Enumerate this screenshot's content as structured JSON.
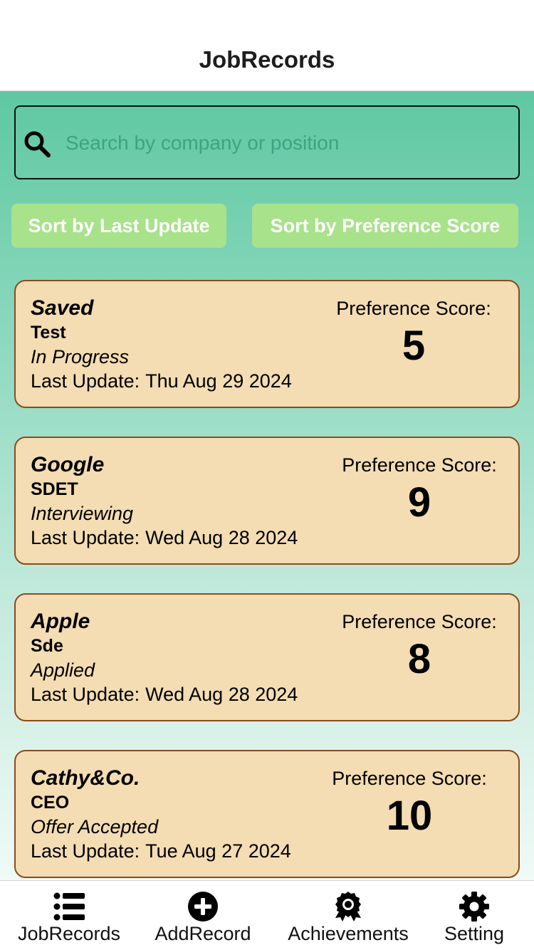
{
  "header": {
    "title": "JobRecords"
  },
  "search": {
    "placeholder": "Search by company or position",
    "value": ""
  },
  "sort": {
    "last_update_label": "Sort by Last Update",
    "preference_label": "Sort by Preference Score"
  },
  "records": [
    {
      "company": "Saved",
      "position": "Test",
      "status": "In Progress",
      "last_update_label": "Last Update:",
      "last_update": "Thu Aug 29 2024",
      "score_label": "Preference Score:",
      "score": "5"
    },
    {
      "company": "Google",
      "position": "SDET",
      "status": "Interviewing",
      "last_update_label": "Last Update:",
      "last_update": "Wed Aug 28 2024",
      "score_label": "Preference Score:",
      "score": "9"
    },
    {
      "company": "Apple",
      "position": "Sde",
      "status": "Applied",
      "last_update_label": "Last Update:",
      "last_update": "Wed Aug 28 2024",
      "score_label": "Preference Score:",
      "score": "8"
    },
    {
      "company": "Cathy&Co.",
      "position": "CEO",
      "status": "Offer Accepted",
      "last_update_label": "Last Update:",
      "last_update": "Tue Aug 27 2024",
      "score_label": "Preference Score:",
      "score": "10"
    }
  ],
  "tabs": [
    {
      "label": "JobRecords",
      "icon": "list-icon"
    },
    {
      "label": "AddRecord",
      "icon": "plus-circle-icon"
    },
    {
      "label": "Achievements",
      "icon": "award-ribbon-icon"
    },
    {
      "label": "Setting",
      "icon": "gear-icon"
    }
  ],
  "colors": {
    "accent_top": "#5ec8a2",
    "button": "#a8e28a",
    "card_bg": "#f4dcb3",
    "card_border": "#8b4a1c"
  }
}
